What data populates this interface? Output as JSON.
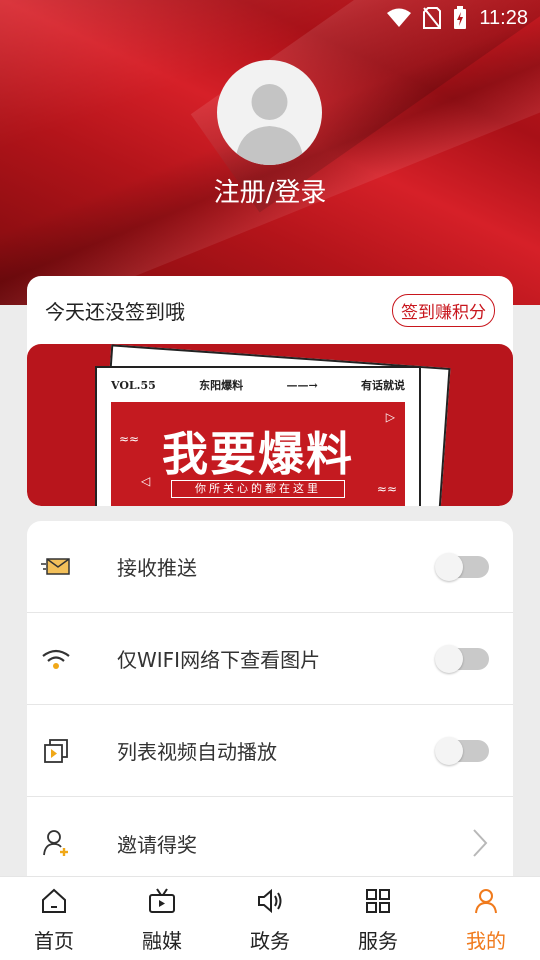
{
  "status": {
    "time": "11:28"
  },
  "profile": {
    "login_text": "注册/登录"
  },
  "signin": {
    "label": "今天还没签到哦",
    "button": "签到赚积分"
  },
  "banner": {
    "vol": "VOL.55",
    "source": "东阳爆料",
    "arrow": "——→",
    "slogan": "有话就说",
    "headline": "我要爆料",
    "subline": "你所关心的都在这里"
  },
  "settings": [
    {
      "label": "接收推送",
      "icon": "mail-icon",
      "control": "toggle",
      "on": false
    },
    {
      "label": "仅WIFI网络下查看图片",
      "icon": "wifi-icon",
      "control": "toggle",
      "on": false
    },
    {
      "label": "列表视频自动播放",
      "icon": "video-icon",
      "control": "toggle",
      "on": false
    },
    {
      "label": "邀请得奖",
      "icon": "invite-user-icon",
      "control": "chevron"
    }
  ],
  "tabs": [
    {
      "label": "首页",
      "icon": "home-icon",
      "active": false
    },
    {
      "label": "融媒",
      "icon": "tv-icon",
      "active": false
    },
    {
      "label": "政务",
      "icon": "speaker-icon",
      "active": false
    },
    {
      "label": "服务",
      "icon": "grid-icon",
      "active": false
    },
    {
      "label": "我的",
      "icon": "user-icon",
      "active": true
    }
  ],
  "colors": {
    "brand_red": "#c8161d",
    "active_orange": "#f07a1c"
  }
}
